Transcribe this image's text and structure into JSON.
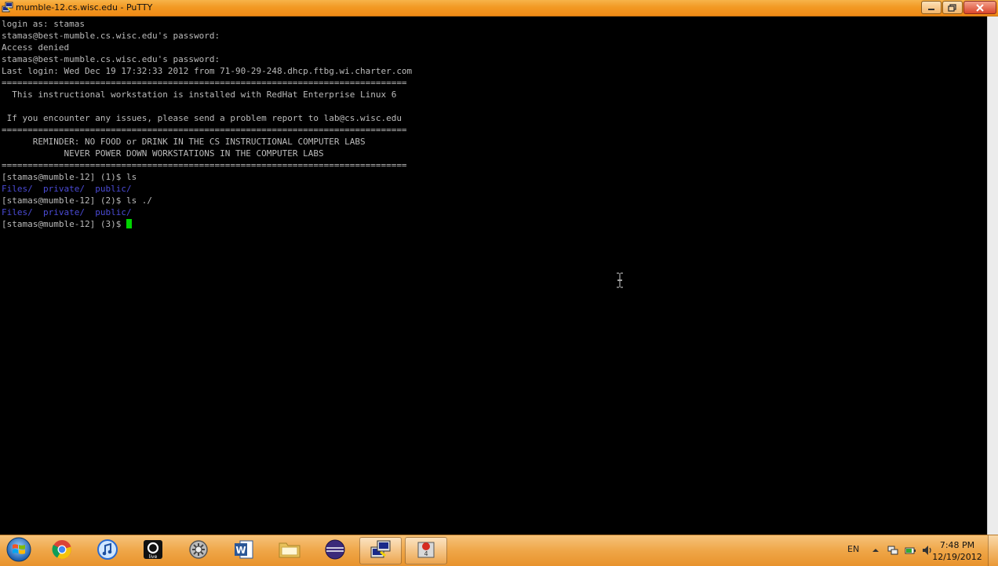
{
  "window": {
    "title": "mumble-12.cs.wisc.edu - PuTTY",
    "app_icon": "putty-icon",
    "controls": [
      "minimize-icon",
      "maximize-icon",
      "close-icon"
    ]
  },
  "terminal": {
    "lines": [
      {
        "text": "login as: stamas"
      },
      {
        "text": "stamas@best-mumble.cs.wisc.edu's password:"
      },
      {
        "text": "Access denied"
      },
      {
        "text": "stamas@best-mumble.cs.wisc.edu's password:"
      },
      {
        "text": "Last login: Wed Dec 19 17:32:33 2012 from 71-90-29-248.dhcp.ftbg.wi.charter.com"
      },
      {
        "text": "=============================================================================="
      },
      {
        "text": "  This instructional workstation is installed with RedHat Enterprise Linux 6"
      },
      {
        "text": ""
      },
      {
        "text": " If you encounter any issues, please send a problem report to lab@cs.wisc.edu"
      },
      {
        "text": "=============================================================================="
      },
      {
        "text": "      REMINDER: NO FOOD or DRINK IN THE CS INSTRUCTIONAL COMPUTER LABS"
      },
      {
        "text": "            NEVER POWER DOWN WORKSTATIONS IN THE COMPUTER LABS"
      },
      {
        "text": "=============================================================================="
      },
      {
        "text": "[stamas@mumble-12] (1)$ ls"
      },
      {
        "dirs": [
          "Files/",
          "private/",
          "public/"
        ]
      },
      {
        "text": "[stamas@mumble-12] (2)$ ls ./"
      },
      {
        "dirs": [
          "Files/",
          "private/",
          "public/"
        ]
      },
      {
        "text": "[stamas@mumble-12] (3)$ ",
        "cursor": true
      }
    ],
    "colors": {
      "text": "#bbbbbb",
      "directory": "#4b4bd6",
      "cursor": "#00d400",
      "background": "#000000"
    }
  },
  "taskbar": {
    "start_icon": "windows-start-icon",
    "apps": [
      {
        "name": "chrome-icon"
      },
      {
        "name": "itunes-icon"
      },
      {
        "name": "live-icon"
      },
      {
        "name": "settings-tool-icon"
      },
      {
        "name": "word-icon"
      },
      {
        "name": "folder-icon"
      },
      {
        "name": "eclipse-icon"
      },
      {
        "name": "putty-icon",
        "active": true
      },
      {
        "name": "recorder-icon",
        "active": true
      }
    ],
    "tray": {
      "language": "EN",
      "icons": [
        "show-hidden-icons-icon",
        "network-icon",
        "power-icon",
        "volume-icon"
      ],
      "time": "7:48 PM",
      "date": "12/19/2012"
    }
  }
}
